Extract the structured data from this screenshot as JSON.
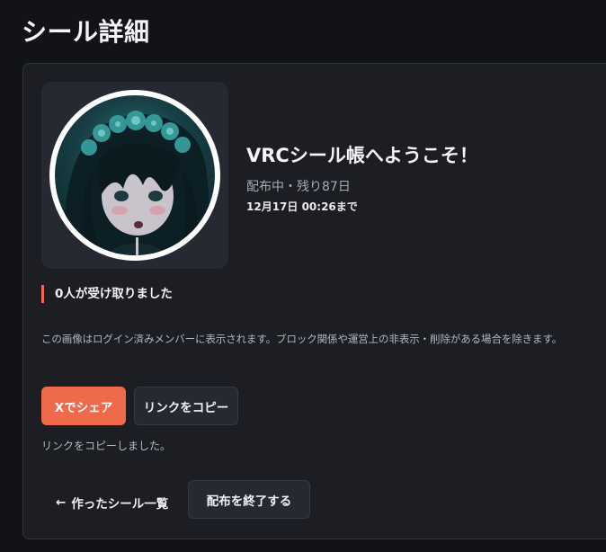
{
  "page": {
    "title": "シール詳細"
  },
  "sticker": {
    "image_alt": "シール画像",
    "title": "VRCシール帳へようこそ！",
    "status": "配布中・残り87日",
    "deadline": "12月17日 00:26まで"
  },
  "receivers": {
    "text": "0人が受け取りました"
  },
  "notice": "この画像はログイン済みメンバーに表示されます。ブロック関係や運営上の非表示・削除がある場合を除きます。",
  "actions": {
    "share_label": "Xでシェア",
    "copy_label": "リンクをコピー",
    "copy_message": "リンクをコピーしました。"
  },
  "footer": {
    "back_arrow": "←",
    "back_label": "作ったシール一覧",
    "end_label": "配布を終了する"
  },
  "colors": {
    "accent": "#ee6a4b",
    "background": "#121317",
    "card": "#1c1e24"
  }
}
